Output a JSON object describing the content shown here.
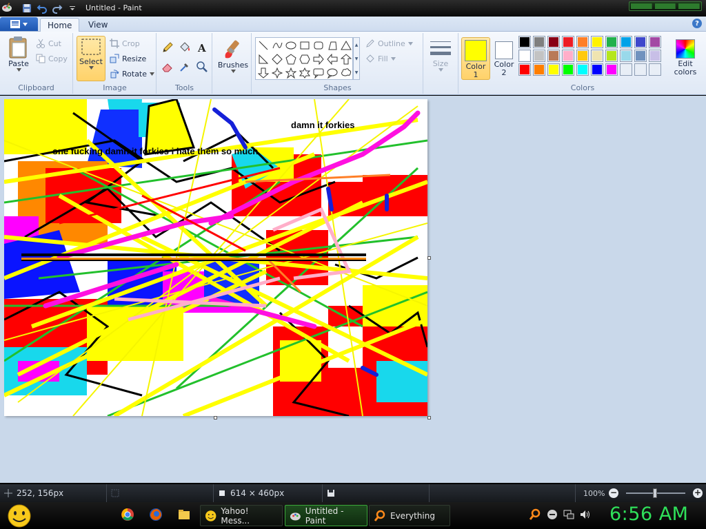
{
  "window": {
    "title": "Untitled - Paint"
  },
  "ribbon": {
    "tabs": [
      "Home",
      "View"
    ],
    "clipboard": {
      "label": "Clipboard",
      "paste": "Paste",
      "cut": "Cut",
      "copy": "Copy"
    },
    "image": {
      "label": "Image",
      "select": "Select",
      "crop": "Crop",
      "resize": "Resize",
      "rotate": "Rotate"
    },
    "tools": {
      "label": "Tools"
    },
    "brushes": {
      "label": "Brushes"
    },
    "shapes": {
      "label": "Shapes",
      "outline": "Outline",
      "fill": "Fill"
    },
    "size": {
      "label": "Size"
    },
    "colors": {
      "label": "Colors",
      "color1_label": "Color",
      "color1_num": "1",
      "color1_value": "#ffff00",
      "color2_label": "Color",
      "color2_num": "2",
      "color2_value": "#ffffff",
      "edit_label": "Edit",
      "edit_label2": "colors",
      "palette": [
        "#000000",
        "#7f7f7f",
        "#880015",
        "#ed1c24",
        "#ff7f27",
        "#fff200",
        "#22b14c",
        "#00a2e8",
        "#3f48cc",
        "#a349a4",
        "#ffffff",
        "#c3c3c3",
        "#b97a57",
        "#ffaec9",
        "#ffc90e",
        "#efe4b0",
        "#b5e61d",
        "#99d9ea",
        "#7092be",
        "#c8bfe7",
        "#ff0000",
        "#ff7f00",
        "#ffff00",
        "#00ff00",
        "#00ffff",
        "#0000ff",
        "#ff00ff",
        "#e8eef6",
        "#e8eef6",
        "#e8eef6"
      ]
    }
  },
  "canvas": {
    "text1": "damn it forkies",
    "text2": "one fucking damn it forkies i hate them so much"
  },
  "statusbar": {
    "cursor": "252, 156px",
    "canvas_size": "614 × 460px",
    "zoom": "100%"
  },
  "taskbar": {
    "tasks": [
      "Yahoo! Mess...",
      "Untitled - Paint",
      "Everything"
    ],
    "clock": "6:56 AM"
  }
}
